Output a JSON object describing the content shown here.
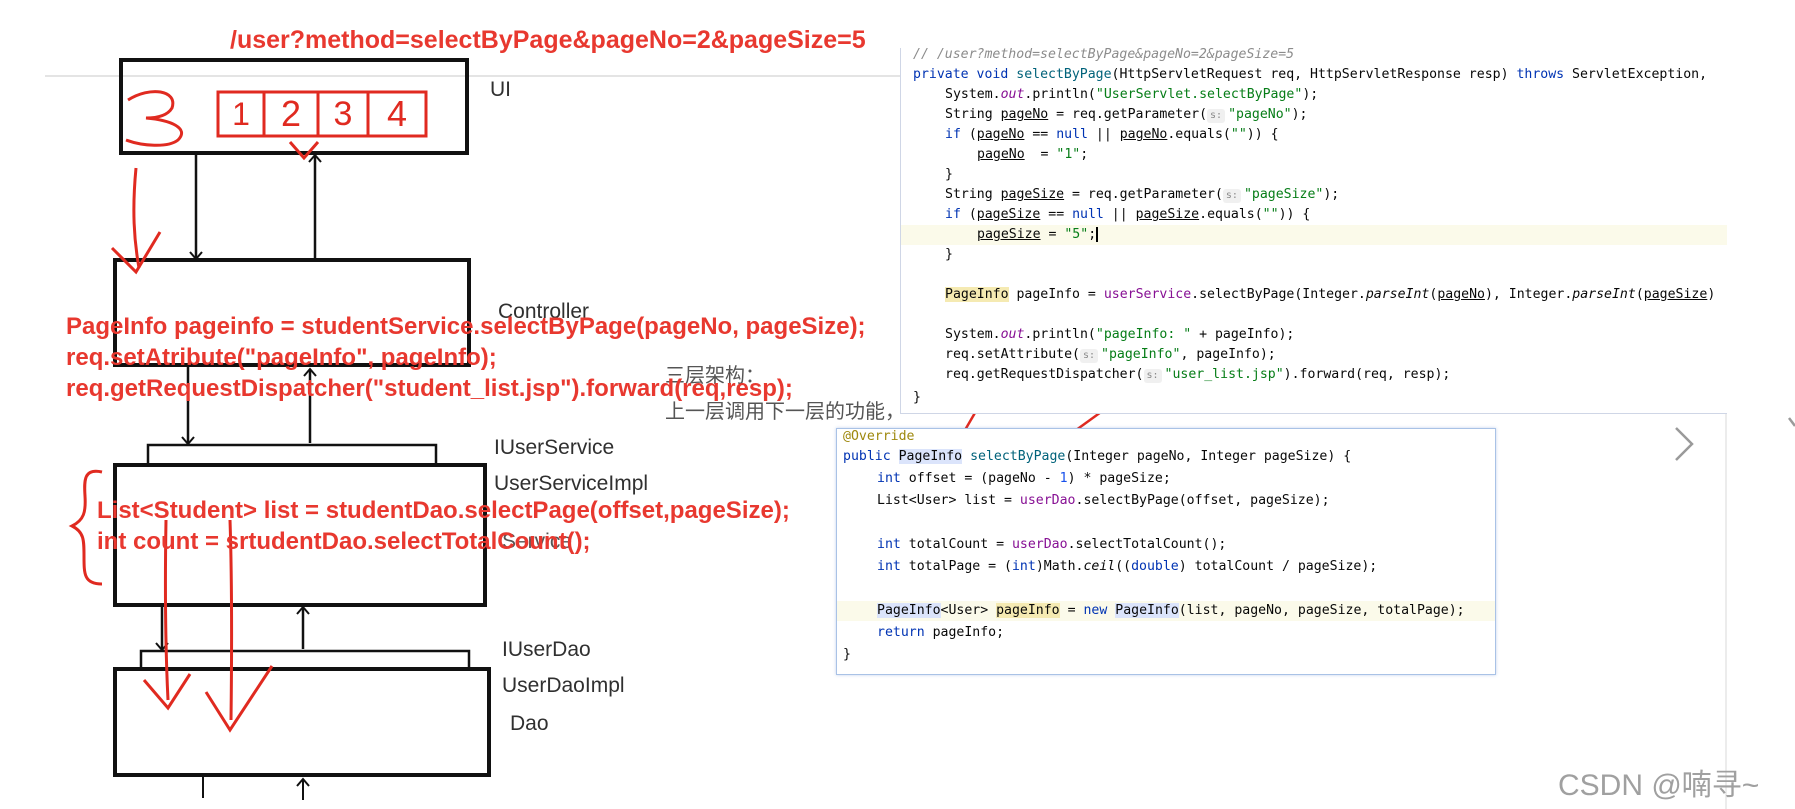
{
  "url_title": "/user?method=selectByPage&pageNo=2&pageSize=5",
  "layers": {
    "ui": "UI",
    "controller": "Controller",
    "iservice": "IUserService",
    "service_impl": "UserServiceImpl",
    "service": "Service",
    "idao": "IUserDao",
    "dao_impl": "UserDaoImpl",
    "dao": "Dao"
  },
  "handwritten": {
    "current_page": "3",
    "page_buttons": [
      "1",
      "2",
      "3",
      "4"
    ]
  },
  "annotations": {
    "controller_code": [
      "PageInfo pageinfo = studentService.selectByPage(pageNo, pageSize);",
      "req.setAtribute(\"pageInfo\", pageInfo);",
      "req.getRequestDispatcher(\"student_list.jsp\").forward(req,resp);"
    ],
    "service_code": [
      "List<Student> list = studentDao.selectPage(offset,pageSize);",
      "int count = srtudentDao.selectTotalCount();"
    ]
  },
  "notes": {
    "title": "三层架构：",
    "line": "上一层调用下一层的功能，"
  },
  "controller_snippet": {
    "comment": "// /user?method=selectByPage&pageNo=2&pageSize=5",
    "signature": {
      "kw1": "private",
      "kw2": "void",
      "method": "selectByPage",
      "params": "(HttpServletRequest req, HttpServletResponse resp) ",
      "throws_kw": "throws",
      "exc": "ServletException,"
    },
    "println1": {
      "pre": "System.",
      "out": "out",
      "call": ".println(",
      "str": "\"UserServlet.selectByPage\"",
      "post": ");"
    },
    "get_page_no": {
      "pre": "String ",
      "var": "pageNo",
      "mid": " = req.getParameter(",
      "hint": "s:",
      "str": "\"pageNo\"",
      "post": ");"
    },
    "if_page_no": {
      "if": "if",
      "a": " (",
      "v1": "pageNo",
      "b": " == ",
      "null": "null",
      "c": " || ",
      "v2": "pageNo",
      "d": ".equals(",
      "str": "\"\"",
      "e": ")) {"
    },
    "assign_page_no": {
      "var": "pageNo",
      "mid": "  = ",
      "str": "\"1\"",
      "post": ";"
    },
    "close1": "}",
    "get_page_size": {
      "pre": "String ",
      "var": "pageSize",
      "mid": " = req.getParameter(",
      "hint": "s:",
      "str": "\"pageSize\"",
      "post": ");"
    },
    "if_page_size": {
      "if": "if",
      "a": " (",
      "v1": "pageSize",
      "b": " == ",
      "null": "null",
      "c": " || ",
      "v2": "pageSize",
      "d": ".equals(",
      "str": "\"\"",
      "e": ")) {"
    },
    "assign_page_size": {
      "var": "pageSize",
      "mid": " = ",
      "str": "\"5\"",
      "post": ";"
    },
    "close2": "}",
    "call_service": {
      "type": "PageInfo",
      "a": " pageInfo = ",
      "svc": "userService",
      "b": ".selectByPage(Integer.",
      "parse1": "parseInt",
      "c": "(",
      "v1": "pageNo",
      "d": "), Integer.",
      "parse2": "parseInt",
      "e": "(",
      "v2": "pageSize",
      "f": ")"
    },
    "println2": {
      "pre": "System.",
      "out": "out",
      "call": ".println(",
      "str": "\"pageInfo: \"",
      "post": " + pageInfo);"
    },
    "set_attr": {
      "pre": "req.setAttribute(",
      "hint": "s:",
      "str": "\"pageInfo\"",
      "post": ", pageInfo);"
    },
    "dispatch": {
      "pre": "req.getRequestDispatcher(",
      "hint": "s:",
      "str": "\"user_list.jsp\"",
      "post": ").forward(req, resp);"
    },
    "close3": "}"
  },
  "service_snippet": {
    "override": "@Override",
    "signature": {
      "kw": "public",
      "type": "PageInfo",
      "method": "selectByPage",
      "params": "(Integer pageNo, Integer pageSize) {"
    },
    "offset": {
      "kw": "int",
      "a": " offset = (pageNo - ",
      "num": "1",
      "b": ") * pageSize;"
    },
    "list": {
      "a": "List<User> list = ",
      "dao": "userDao",
      "b": ".selectByPage(offset, pageSize);"
    },
    "total_count": {
      "kw": "int",
      "a": " totalCount = ",
      "dao": "userDao",
      "b": ".selectTotalCount();"
    },
    "total_page": {
      "kw": "int",
      "a": " totalPage = (",
      "kw2": "int",
      "b": ")Math.",
      "ceil": "ceil",
      "c": "((",
      "kw3": "double",
      "d": ") totalCount / pageSize);"
    },
    "new_info": {
      "type": "PageInfo",
      "a": "<User> ",
      "var": "pageInfo",
      "b": " = ",
      "kw": "new",
      "c": " ",
      "type2": "PageInfo",
      "d": "(list, pageNo, pageSize, totalPage);"
    },
    "ret": {
      "kw": "return",
      "a": " pageInfo;"
    },
    "close": "}"
  },
  "watermark": "CSDN @喃寻~",
  "colors": {
    "annotation_red": "#e8382f",
    "keyword": "#0033b3",
    "string": "#067d17",
    "panel_border": "#a9c2e6"
  }
}
